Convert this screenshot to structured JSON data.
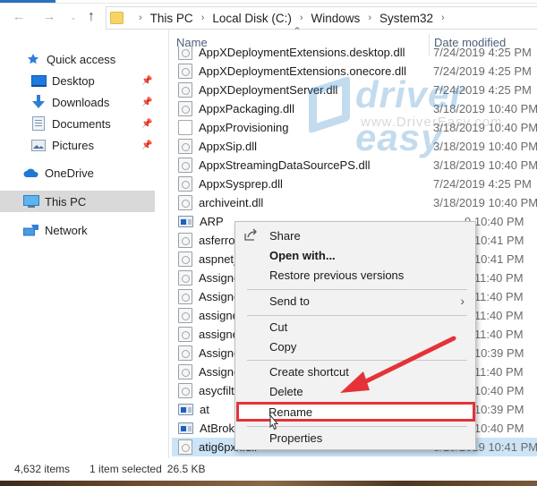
{
  "nav": {
    "back_icon": "arrow-left-icon",
    "forward_icon": "arrow-right-icon",
    "recent_icon": "chevron-down-icon",
    "up_icon": "arrow-up-icon",
    "breadcrumb": [
      "This PC",
      "Local Disk (C:)",
      "Windows",
      "System32"
    ]
  },
  "sidebar": {
    "items": [
      {
        "label": "Quick access",
        "icon": "star-icon",
        "pinned": false
      },
      {
        "label": "Desktop",
        "icon": "desktop-icon",
        "pinned": true
      },
      {
        "label": "Downloads",
        "icon": "download-icon",
        "pinned": true
      },
      {
        "label": "Documents",
        "icon": "documents-icon",
        "pinned": true
      },
      {
        "label": "Pictures",
        "icon": "pictures-icon",
        "pinned": true
      },
      {
        "label": "OneDrive",
        "icon": "cloud-icon",
        "pinned": false
      },
      {
        "label": "This PC",
        "icon": "computer-icon",
        "pinned": false,
        "selected": true
      },
      {
        "label": "Network",
        "icon": "network-icon",
        "pinned": false
      }
    ]
  },
  "columns": {
    "name": "Name",
    "date": "Date modified"
  },
  "files": [
    {
      "name": "AppXDeploymentExtensions.desktop.dll",
      "date": "7/24/2019 4:25 PM",
      "type": "dll"
    },
    {
      "name": "AppXDeploymentExtensions.onecore.dll",
      "date": "7/24/2019 4:25 PM",
      "type": "dll"
    },
    {
      "name": "AppXDeploymentServer.dll",
      "date": "7/24/2019 4:25 PM",
      "type": "dll"
    },
    {
      "name": "AppxPackaging.dll",
      "date": "3/18/2019 10:40 PM",
      "type": "dll"
    },
    {
      "name": "AppxProvisioning",
      "date": "3/18/2019 10:40 PM",
      "type": "plain"
    },
    {
      "name": "AppxSip.dll",
      "date": "3/18/2019 10:40 PM",
      "type": "dll"
    },
    {
      "name": "AppxStreamingDataSourcePS.dll",
      "date": "3/18/2019 10:40 PM",
      "type": "dll"
    },
    {
      "name": "AppxSysprep.dll",
      "date": "7/24/2019 4:25 PM",
      "type": "dll"
    },
    {
      "name": "archiveint.dll",
      "date": "3/18/2019 10:40 PM",
      "type": "dll"
    },
    {
      "name": "ARP",
      "date": "9 10:40 PM",
      "type": "app"
    },
    {
      "name": "asferror",
      "date": "9 10:41 PM",
      "type": "dll"
    },
    {
      "name": "aspnet_",
      "date": "9 10:41 PM",
      "type": "dll"
    },
    {
      "name": "Assigne",
      "date": "9 11:40 PM",
      "type": "dll"
    },
    {
      "name": "Assigne",
      "date": "9 11:40 PM",
      "type": "dll"
    },
    {
      "name": "assigne",
      "date": "9 11:40 PM",
      "type": "dll"
    },
    {
      "name": "assigne",
      "date": "9 11:40 PM",
      "type": "dll"
    },
    {
      "name": "Assigne",
      "date": "9 10:39 PM",
      "type": "dll"
    },
    {
      "name": "Assigne",
      "date": "9 11:40 PM",
      "type": "dll"
    },
    {
      "name": "asycfilt",
      "date": "9 10:40 PM",
      "type": "dll"
    },
    {
      "name": "at",
      "date": "9 10:39 PM",
      "type": "app"
    },
    {
      "name": "AtBroke",
      "date": "9 10:40 PM",
      "type": "app"
    },
    {
      "name": "atig6pxx.dll",
      "date": "3/18/2019 10:41 PM",
      "type": "dll",
      "selected": true
    }
  ],
  "context_menu": {
    "items": [
      {
        "label": "Share",
        "icon": "share-icon"
      },
      {
        "label": "Open with...",
        "bold": true
      },
      {
        "label": "Restore previous versions"
      },
      {
        "separator": true
      },
      {
        "label": "Send to",
        "submenu": true
      },
      {
        "separator": true
      },
      {
        "label": "Cut"
      },
      {
        "label": "Copy"
      },
      {
        "separator": true
      },
      {
        "label": "Create shortcut"
      },
      {
        "label": "Delete"
      },
      {
        "label": "Rename",
        "highlighted": true
      },
      {
        "separator": true
      },
      {
        "label": "Properties"
      }
    ]
  },
  "annotation": {
    "color": "#e53238",
    "target": "Rename"
  },
  "watermark": {
    "brand": "driver easy",
    "url": "www.DriverEasy.com"
  },
  "status": {
    "item_count": "4,632 items",
    "selection": "1 item selected",
    "size": "26.5 KB"
  }
}
